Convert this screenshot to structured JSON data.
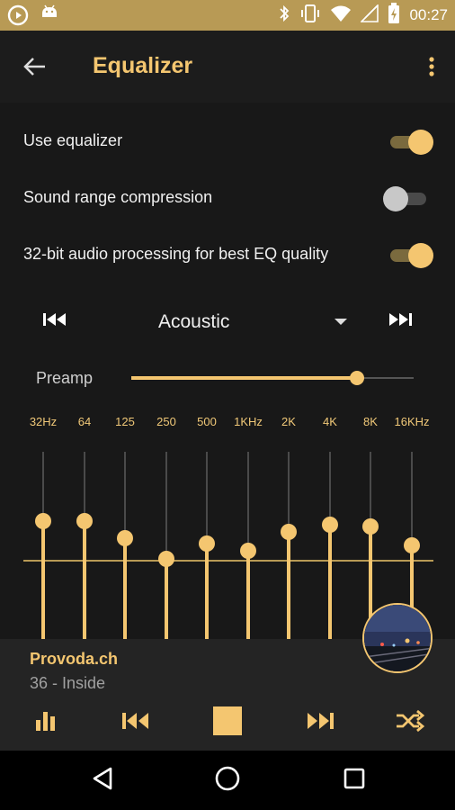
{
  "status_bar": {
    "time": "00:27",
    "left_icons": [
      "play-circle-icon",
      "android-icon"
    ],
    "right_icons": [
      "bluetooth-icon",
      "vibrate-icon",
      "wifi-icon",
      "signal-icon",
      "battery-charging-icon"
    ]
  },
  "app_bar": {
    "title": "Equalizer",
    "back_icon": "arrow-left-icon",
    "menu_icon": "more-vert-icon"
  },
  "settings": [
    {
      "label": "Use equalizer",
      "enabled": true
    },
    {
      "label": "Sound range compression",
      "enabled": false
    },
    {
      "label": "32-bit audio processing for best EQ quality",
      "enabled": true
    }
  ],
  "preset": {
    "name": "Acoustic",
    "prev_icon": "skip-previous-icon",
    "next_icon": "skip-next-icon"
  },
  "preamp": {
    "label": "Preamp",
    "level": 0.8
  },
  "eq": {
    "bands": [
      {
        "label": "32Hz",
        "level": 0.63
      },
      {
        "label": "64",
        "level": 0.63
      },
      {
        "label": "125",
        "level": 0.54
      },
      {
        "label": "250",
        "level": 0.43
      },
      {
        "label": "500",
        "level": 0.51
      },
      {
        "label": "1KHz",
        "level": 0.47
      },
      {
        "label": "2K",
        "level": 0.57
      },
      {
        "label": "4K",
        "level": 0.61
      },
      {
        "label": "8K",
        "level": 0.6
      },
      {
        "label": "16KHz",
        "level": 0.5
      }
    ]
  },
  "player": {
    "artist": "Provoda.ch",
    "track": "36 - Inside",
    "controls": [
      "equalizer-icon",
      "skip-previous-icon",
      "stop-icon",
      "skip-next-icon",
      "shuffle-icon"
    ]
  },
  "nav_bar": {
    "buttons": [
      "back-triangle-icon",
      "home-circle-icon",
      "recents-square-icon"
    ]
  },
  "colors": {
    "accent": "#f4c670",
    "status_bar": "#b89a55",
    "background": "#181818",
    "player_background": "#242424"
  }
}
